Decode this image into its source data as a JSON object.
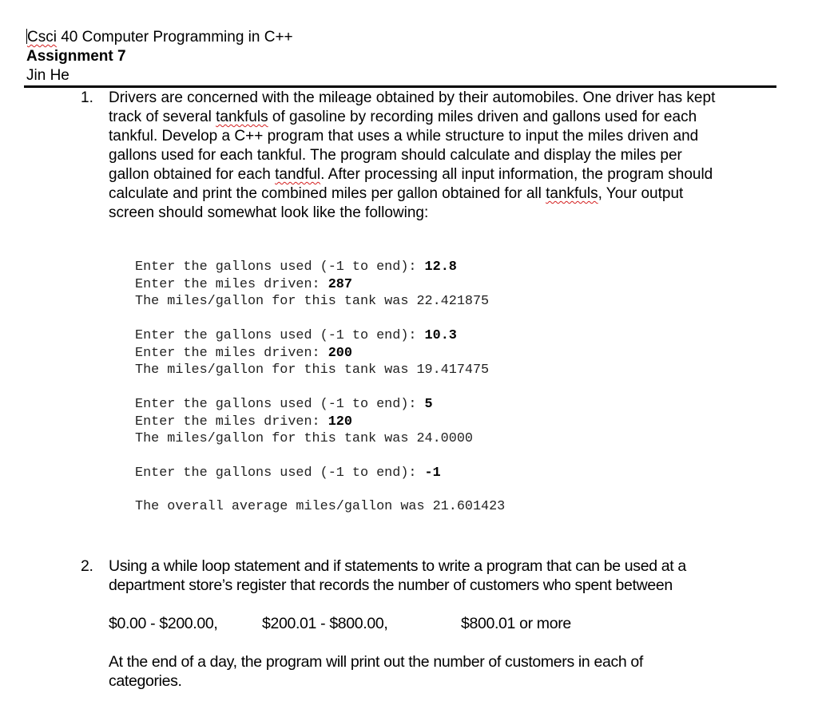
{
  "header": {
    "course_prefix": "Csci",
    "course_rest": " 40 Computer Programming in C++",
    "assignment": "Assignment 7",
    "author": "Jin He"
  },
  "question1": {
    "number": "1.",
    "lines": [
      "Drivers are concerned with the mileage obtained by their automobiles. One driver has kept",
      [
        "track of several ",
        "tankfuls",
        " of gasoline by recording miles driven and gallons used for each"
      ],
      "tankful. Develop a C++ program that uses a while structure to input the miles driven and",
      "gallons used for each tankful. The program should calculate and display the miles per",
      [
        "gallon obtained for each ",
        "tandful",
        ". After processing all input information, the program should"
      ],
      [
        "calculate and print the combined miles per gallon obtained for all ",
        "tankfuls",
        ", Your output"
      ],
      "screen should somewhat look like the following:"
    ]
  },
  "console": [
    {
      "text": "Enter the gallons used (-1 to end): ",
      "input": "12.8"
    },
    {
      "text": "Enter the miles driven: ",
      "input": "287"
    },
    {
      "text": "The miles/gallon for this tank was 22.421875",
      "input": ""
    },
    {
      "text": "Enter the gallons used (-1 to end): ",
      "input": "10.3"
    },
    {
      "text": "Enter the miles driven: ",
      "input": "200"
    },
    {
      "text": "The miles/gallon for this tank was 19.417475",
      "input": ""
    },
    {
      "text": "Enter the gallons used (-1 to end): ",
      "input": "5"
    },
    {
      "text": "Enter the miles driven: ",
      "input": "120"
    },
    {
      "text": "The miles/gallon for this tank was 24.0000",
      "input": ""
    },
    {
      "text": "Enter the gallons used (-1 to end): ",
      "input": "-1"
    },
    {
      "text": "The overall average miles/gallon was 21.601423",
      "input": ""
    }
  ],
  "question2": {
    "number": "2.",
    "lines": [
      "Using a while loop statement and if statements to write a program that can be used at a",
      "department store’s register that records the number of customers who spent between"
    ],
    "ranges": [
      "$0.00 - $200.00,",
      "$200.01 - $800.00,",
      "$800.01 or more"
    ],
    "closing_lines": [
      "At the end of a day, the program will print out the number of customers in each of",
      "categories."
    ]
  }
}
